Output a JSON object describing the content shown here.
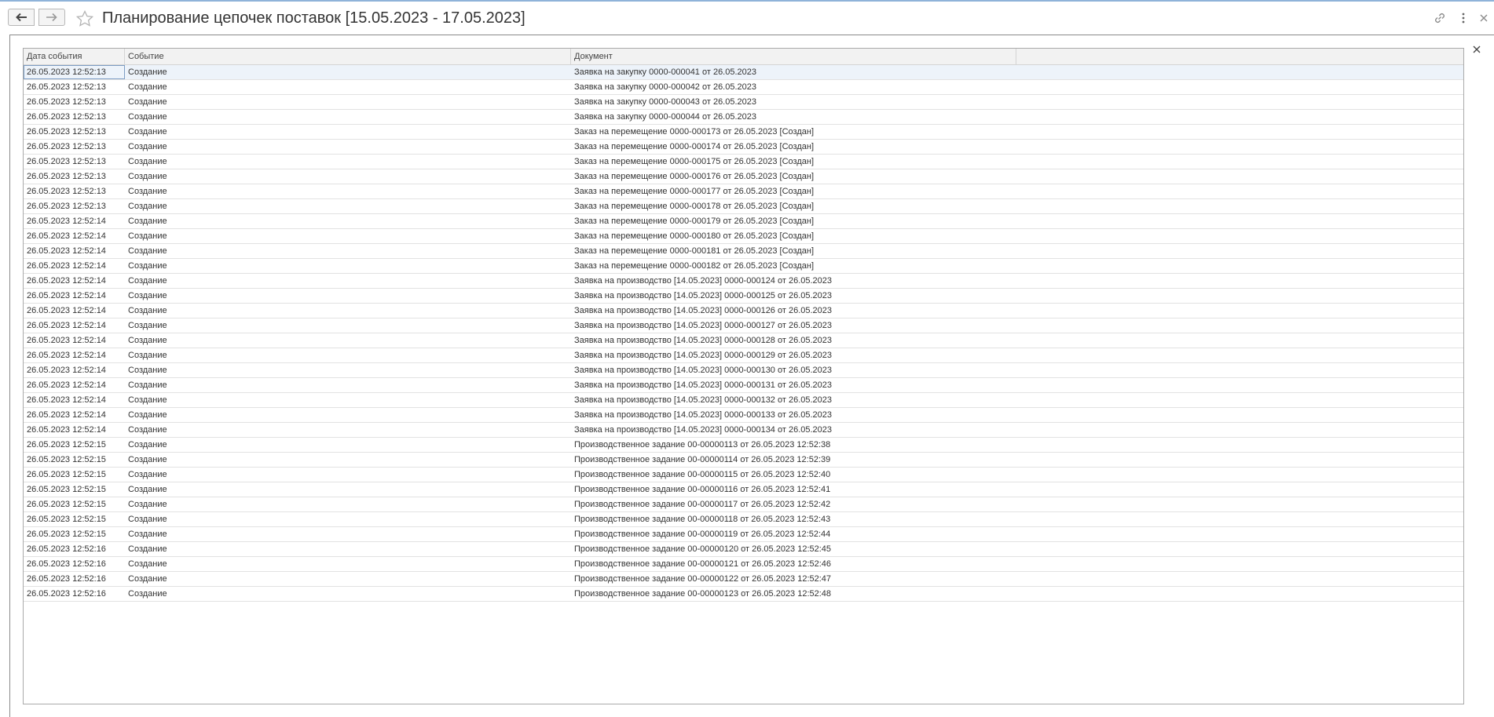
{
  "window": {
    "title": "Планирование цепочек поставок [15.05.2023 - 17.05.2023]"
  },
  "table": {
    "columns": [
      "Дата события",
      "Событие",
      "Документ",
      ""
    ],
    "selected_row": 0,
    "rows": [
      [
        "26.05.2023 12:52:13",
        "Создание",
        "Заявка на закупку 0000-000041 от 26.05.2023"
      ],
      [
        "26.05.2023 12:52:13",
        "Создание",
        "Заявка на закупку 0000-000042 от 26.05.2023"
      ],
      [
        "26.05.2023 12:52:13",
        "Создание",
        "Заявка на закупку 0000-000043 от 26.05.2023"
      ],
      [
        "26.05.2023 12:52:13",
        "Создание",
        "Заявка на закупку 0000-000044 от 26.05.2023"
      ],
      [
        "26.05.2023 12:52:13",
        "Создание",
        "Заказ на перемещение 0000-000173 от 26.05.2023 [Создан]"
      ],
      [
        "26.05.2023 12:52:13",
        "Создание",
        "Заказ на перемещение 0000-000174 от 26.05.2023 [Создан]"
      ],
      [
        "26.05.2023 12:52:13",
        "Создание",
        "Заказ на перемещение 0000-000175 от 26.05.2023 [Создан]"
      ],
      [
        "26.05.2023 12:52:13",
        "Создание",
        "Заказ на перемещение 0000-000176 от 26.05.2023 [Создан]"
      ],
      [
        "26.05.2023 12:52:13",
        "Создание",
        "Заказ на перемещение 0000-000177 от 26.05.2023 [Создан]"
      ],
      [
        "26.05.2023 12:52:13",
        "Создание",
        "Заказ на перемещение 0000-000178 от 26.05.2023 [Создан]"
      ],
      [
        "26.05.2023 12:52:14",
        "Создание",
        "Заказ на перемещение 0000-000179 от 26.05.2023 [Создан]"
      ],
      [
        "26.05.2023 12:52:14",
        "Создание",
        "Заказ на перемещение 0000-000180 от 26.05.2023 [Создан]"
      ],
      [
        "26.05.2023 12:52:14",
        "Создание",
        "Заказ на перемещение 0000-000181 от 26.05.2023 [Создан]"
      ],
      [
        "26.05.2023 12:52:14",
        "Создание",
        "Заказ на перемещение 0000-000182 от 26.05.2023 [Создан]"
      ],
      [
        "26.05.2023 12:52:14",
        "Создание",
        "Заявка на производство [14.05.2023] 0000-000124 от 26.05.2023"
      ],
      [
        "26.05.2023 12:52:14",
        "Создание",
        "Заявка на производство [14.05.2023] 0000-000125 от 26.05.2023"
      ],
      [
        "26.05.2023 12:52:14",
        "Создание",
        "Заявка на производство [14.05.2023] 0000-000126 от 26.05.2023"
      ],
      [
        "26.05.2023 12:52:14",
        "Создание",
        "Заявка на производство [14.05.2023] 0000-000127 от 26.05.2023"
      ],
      [
        "26.05.2023 12:52:14",
        "Создание",
        "Заявка на производство [14.05.2023] 0000-000128 от 26.05.2023"
      ],
      [
        "26.05.2023 12:52:14",
        "Создание",
        "Заявка на производство [14.05.2023] 0000-000129 от 26.05.2023"
      ],
      [
        "26.05.2023 12:52:14",
        "Создание",
        "Заявка на производство [14.05.2023] 0000-000130 от 26.05.2023"
      ],
      [
        "26.05.2023 12:52:14",
        "Создание",
        "Заявка на производство [14.05.2023] 0000-000131 от 26.05.2023"
      ],
      [
        "26.05.2023 12:52:14",
        "Создание",
        "Заявка на производство [14.05.2023] 0000-000132 от 26.05.2023"
      ],
      [
        "26.05.2023 12:52:14",
        "Создание",
        "Заявка на производство [14.05.2023] 0000-000133 от 26.05.2023"
      ],
      [
        "26.05.2023 12:52:14",
        "Создание",
        "Заявка на производство [14.05.2023] 0000-000134 от 26.05.2023"
      ],
      [
        "26.05.2023 12:52:15",
        "Создание",
        "Производственное задание 00-00000113 от 26.05.2023 12:52:38"
      ],
      [
        "26.05.2023 12:52:15",
        "Создание",
        "Производственное задание 00-00000114 от 26.05.2023 12:52:39"
      ],
      [
        "26.05.2023 12:52:15",
        "Создание",
        "Производственное задание 00-00000115 от 26.05.2023 12:52:40"
      ],
      [
        "26.05.2023 12:52:15",
        "Создание",
        "Производственное задание 00-00000116 от 26.05.2023 12:52:41"
      ],
      [
        "26.05.2023 12:52:15",
        "Создание",
        "Производственное задание 00-00000117 от 26.05.2023 12:52:42"
      ],
      [
        "26.05.2023 12:52:15",
        "Создание",
        "Производственное задание 00-00000118 от 26.05.2023 12:52:43"
      ],
      [
        "26.05.2023 12:52:15",
        "Создание",
        "Производственное задание 00-00000119 от 26.05.2023 12:52:44"
      ],
      [
        "26.05.2023 12:52:16",
        "Создание",
        "Производственное задание 00-00000120 от 26.05.2023 12:52:45"
      ],
      [
        "26.05.2023 12:52:16",
        "Создание",
        "Производственное задание 00-00000121 от 26.05.2023 12:52:46"
      ],
      [
        "26.05.2023 12:52:16",
        "Создание",
        "Производственное задание 00-00000122 от 26.05.2023 12:52:47"
      ],
      [
        "26.05.2023 12:52:16",
        "Создание",
        "Производственное задание 00-00000123 от 26.05.2023 12:52:48"
      ]
    ]
  },
  "icons": {
    "back": "arrow-left-icon",
    "forward": "arrow-right-icon",
    "favorite": "star-icon",
    "link": "link-icon",
    "more": "more-vertical-icon",
    "close": "close-icon"
  },
  "colors": {
    "accent": "#8fb3d9",
    "selected_row": "#edf3fa",
    "header_bg": "#f2f2f2"
  }
}
